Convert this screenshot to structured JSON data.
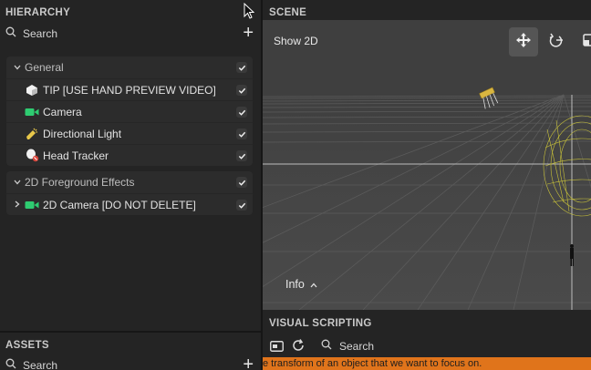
{
  "hierarchy": {
    "title": "HIERARCHY",
    "search_placeholder": "Search",
    "groups": [
      {
        "label": "General",
        "checked": true,
        "items": [
          {
            "label": "TIP [USE HAND PREVIEW VIDEO]",
            "icon": "hand-tip-icon",
            "checked": true
          },
          {
            "label": "Camera",
            "icon": "camera-icon",
            "checked": true
          },
          {
            "label": "Directional Light",
            "icon": "light-icon",
            "checked": true
          },
          {
            "label": "Head Tracker",
            "icon": "head-tracker-icon",
            "checked": true
          }
        ]
      },
      {
        "label": "2D Foreground Effects",
        "checked": true,
        "items": [
          {
            "label": "2D Camera [DO NOT DELETE]",
            "icon": "camera-icon",
            "checked": true
          }
        ]
      }
    ]
  },
  "assets": {
    "title": "ASSETS",
    "search_placeholder": "Search"
  },
  "scene": {
    "title": "SCENE",
    "show2d_label": "Show 2D",
    "info_label": "Info",
    "tools": [
      "move-icon",
      "rotate-icon",
      "scale-icon"
    ]
  },
  "visual_scripting": {
    "title": "VISUAL SCRIPTING",
    "search_placeholder": "Search",
    "banner_text": "e transform of an object that we want to focus on."
  },
  "colors": {
    "background": "#242424",
    "group_bg": "#2c2c2c",
    "viewport_bg": "#3f3f3f",
    "camera_green": "#2ecc71",
    "light_yellow": "#e8c84a",
    "banner_orange": "#e0741b"
  }
}
